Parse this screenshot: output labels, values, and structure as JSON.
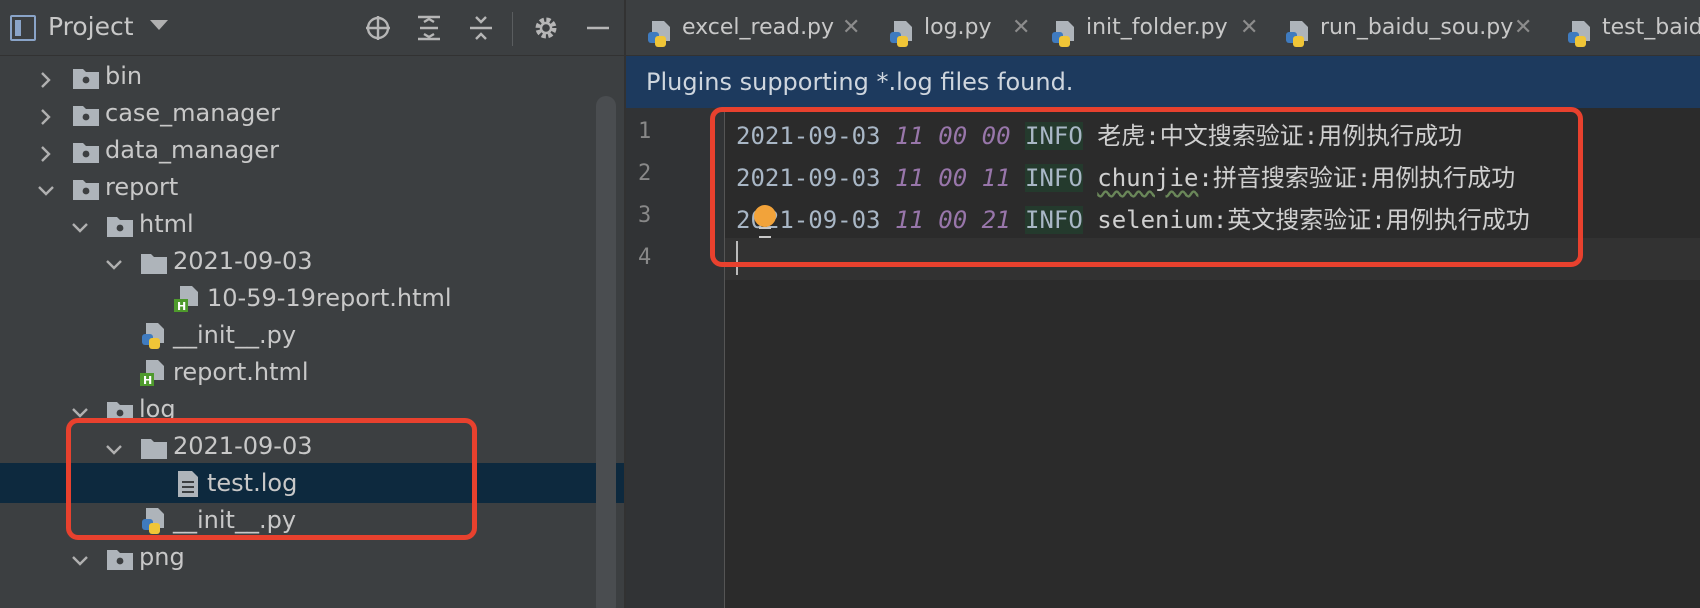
{
  "project_panel": {
    "title": "Project",
    "tree": [
      {
        "label": "bin",
        "type": "module-folder",
        "expanded": false
      },
      {
        "label": "case_manager",
        "type": "module-folder",
        "expanded": false
      },
      {
        "label": "data_manager",
        "type": "module-folder",
        "expanded": false
      },
      {
        "label": "report",
        "type": "module-folder",
        "expanded": true
      },
      {
        "label": "html",
        "type": "module-folder",
        "expanded": true
      },
      {
        "label": "2021-09-03",
        "type": "folder",
        "expanded": true
      },
      {
        "label": "10-59-19report.html",
        "type": "html-file"
      },
      {
        "label": "__init__.py",
        "type": "python-file"
      },
      {
        "label": "report.html",
        "type": "html-file"
      },
      {
        "label": "log",
        "type": "module-folder",
        "expanded": true
      },
      {
        "label": "2021-09-03",
        "type": "folder",
        "expanded": true
      },
      {
        "label": "test.log",
        "type": "text-file",
        "selected": true
      },
      {
        "label": "__init__.py",
        "type": "python-file"
      },
      {
        "label": "png",
        "type": "module-folder",
        "expanded": true
      }
    ]
  },
  "tabs": [
    {
      "label": "excel_read.py"
    },
    {
      "label": "log.py"
    },
    {
      "label": "init_folder.py"
    },
    {
      "label": "run_baidu_sou.py"
    },
    {
      "label": "test_baidu"
    }
  ],
  "banner": {
    "text": "Plugins supporting *.log files found."
  },
  "editor": {
    "line_numbers": [
      "1",
      "2",
      "3",
      "4"
    ],
    "lines": [
      {
        "date": "2021-09-03",
        "time": "11 00 00",
        "level": "INFO",
        "message": "老虎:中文搜索验证:用例执行成功"
      },
      {
        "date": "2021-09-03",
        "time": "11 00 11",
        "level": "INFO",
        "message_highlight": "chunjie",
        "message": ":拼音搜索验证:用例执行成功"
      },
      {
        "date": "2021-09-03",
        "time": "11 00 21",
        "level": "INFO",
        "message": "selenium:英文搜索验证:用例执行成功"
      }
    ]
  },
  "colors": {
    "annotation_box": "#e8412e",
    "selection": "#0d293e",
    "banner": "#1d3a5e"
  }
}
